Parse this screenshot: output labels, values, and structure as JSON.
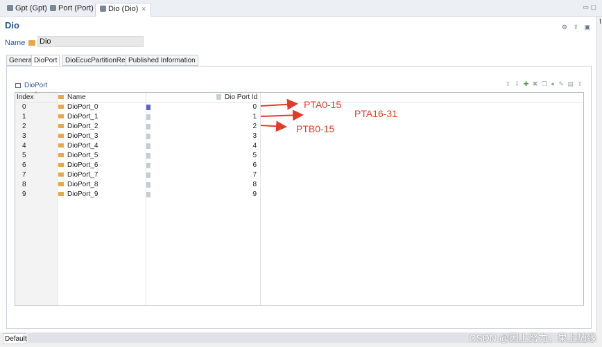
{
  "tabs": [
    {
      "label": "Gpt (Gpt)"
    },
    {
      "label": "Port (Port)"
    },
    {
      "label": "Dio (Dio)",
      "close": "✕"
    }
  ],
  "window_controls": "▭ ▢",
  "edge_char": "t",
  "editor": {
    "title": "Dio",
    "name_label": "Name",
    "name_value": "Dio"
  },
  "subtabs": [
    {
      "label": "General"
    },
    {
      "label": "DioPort"
    },
    {
      "label": "DioEcucPartitionRef"
    },
    {
      "label": "Published Information"
    }
  ],
  "section": {
    "title": "DioPort"
  },
  "table": {
    "columns": [
      "Index",
      "Name",
      "Dio Port Id"
    ],
    "rows": [
      {
        "index": "0",
        "name": "DioPort_0",
        "id": "0"
      },
      {
        "index": "1",
        "name": "DioPort_1",
        "id": "1"
      },
      {
        "index": "2",
        "name": "DioPort_2",
        "id": "2"
      },
      {
        "index": "3",
        "name": "DioPort_3",
        "id": "3"
      },
      {
        "index": "4",
        "name": "DioPort_4",
        "id": "4"
      },
      {
        "index": "5",
        "name": "DioPort_5",
        "id": "5"
      },
      {
        "index": "6",
        "name": "DioPort_6",
        "id": "6"
      },
      {
        "index": "7",
        "name": "DioPort_7",
        "id": "7"
      },
      {
        "index": "8",
        "name": "DioPort_8",
        "id": "8"
      },
      {
        "index": "9",
        "name": "DioPort_9",
        "id": "9"
      }
    ]
  },
  "annotations": {
    "a0": "PTA0-15",
    "a1": "PTA16-31",
    "a2": "PTB0-15",
    "color": "#e13b2b"
  },
  "footer": {
    "tab": "Default"
  },
  "watermark": "CSDN @因上努力，果上随缘",
  "colors": {
    "accent": "#2454a0",
    "annotation": "#e13b2b",
    "folder": "#e7a84a"
  }
}
